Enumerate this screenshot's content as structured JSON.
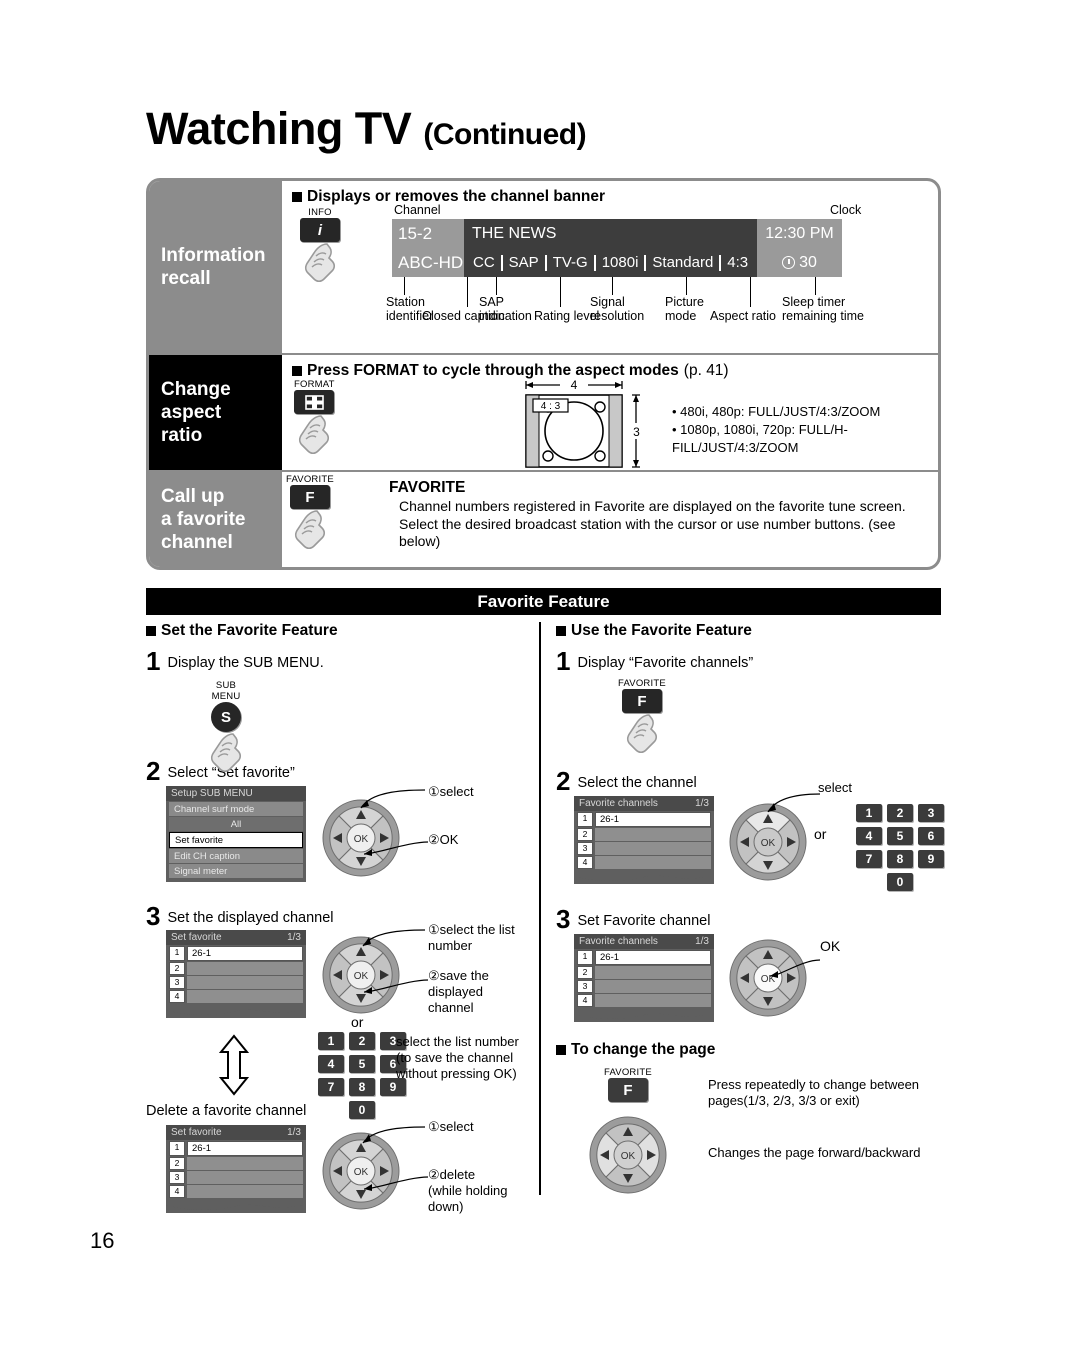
{
  "page": {
    "title_main": "Watching TV",
    "title_cont": "(Continued)",
    "number": "16"
  },
  "feature_table": {
    "rows": [
      {
        "label": "Information\nrecall",
        "label_line1": "Information",
        "label_line2": "recall",
        "heading": "Displays or removes the channel banner",
        "key": {
          "cap": "INFO",
          "glyph": "i"
        },
        "banner": {
          "caption_channel": "Channel",
          "caption_clock": "Clock",
          "channel_number": "15-2",
          "station_identifier": "ABC-HD",
          "program_title": "THE NEWS",
          "clock": "12:30 PM",
          "sleep_timer": "30",
          "items": [
            "CC",
            "SAP",
            "TV-G",
            "1080i",
            "Standard",
            "4:3"
          ],
          "labels": {
            "station": "Station\nidentifier",
            "sap": "SAP\nindication",
            "signal": "Signal\nresolution",
            "picture": "Picture\nmode",
            "sleep": "Sleep timer\nremaining time",
            "closed_caption": "Closed caption",
            "rating": "Rating level",
            "aspect": "Aspect ratio"
          }
        }
      },
      {
        "label_line1": "Change",
        "label_line2": "aspect",
        "label_line3": "ratio",
        "heading": "Press FORMAT to cycle through the aspect modes",
        "heading_page": "(p. 41)",
        "key": {
          "cap": "FORMAT",
          "glyph": "format-icon"
        },
        "diagram": {
          "width_label": "4",
          "height_label": "3",
          "inner_label": "4 : 3"
        },
        "modes": [
          "480i, 480p:  FULL/JUST/4:3/ZOOM",
          "1080p, 1080i, 720p:  FULL/H-FILL/JUST/4:3/ZOOM"
        ]
      },
      {
        "label_line1": "Call up",
        "label_line2": "a favorite",
        "label_line3": "channel",
        "heading": "FAVORITE",
        "key": {
          "cap": "FAVORITE",
          "glyph": "F"
        },
        "body": "Channel numbers registered in Favorite are displayed on the favorite tune screen. Select the desired broadcast station with the cursor or use number buttons. (see below)"
      }
    ]
  },
  "favorite_section": {
    "bar_title": "Favorite Feature",
    "left": {
      "heading": "Set the Favorite Feature",
      "step1": {
        "num": "1",
        "text": "Display the SUB MENU.",
        "key": {
          "cap_line1": "SUB",
          "cap_line2": "MENU",
          "glyph": "S"
        }
      },
      "step2": {
        "num": "2",
        "text": "Select “Set favorite”",
        "menu": {
          "title": "Setup SUB MENU",
          "items": [
            "Channel surf mode",
            "All",
            "Set favorite",
            "Edit CH caption",
            "Signal meter"
          ],
          "selected": "Set favorite"
        },
        "annotations": [
          "①select",
          "②OK"
        ]
      },
      "step3": {
        "num": "3",
        "text": "Set the displayed channel",
        "list": {
          "title": "Set favorite",
          "page": "1/3",
          "rows": [
            {
              "num": "1",
              "value": "26-1"
            },
            {
              "num": "2",
              "value": ""
            },
            {
              "num": "3",
              "value": ""
            },
            {
              "num": "4",
              "value": ""
            }
          ]
        },
        "annotations": [
          "①select the list\n   number",
          "②save the displayed\n   channel"
        ],
        "or_label": "or",
        "numpad": [
          "1",
          "2",
          "3",
          "4",
          "5",
          "6",
          "7",
          "8",
          "9",
          "0"
        ],
        "numpad_note": "select the list number\n(to save the channel\nwithout pressing OK)"
      },
      "delete": {
        "text": "Delete a favorite channel",
        "list": {
          "title": "Set favorite",
          "page": "1/3",
          "rows": [
            {
              "num": "1",
              "value": "26-1"
            },
            {
              "num": "2",
              "value": ""
            },
            {
              "num": "3",
              "value": ""
            },
            {
              "num": "4",
              "value": ""
            }
          ]
        },
        "annotations": [
          "①select",
          "②delete\n   (while holding down)"
        ]
      }
    },
    "right": {
      "heading": "Use the Favorite Feature",
      "step1": {
        "num": "1",
        "text": "Display “Favorite channels”",
        "key": {
          "cap": "FAVORITE",
          "glyph": "F"
        }
      },
      "step2": {
        "num": "2",
        "text": "Select the channel",
        "list": {
          "title": "Favorite channels",
          "page": "1/3",
          "rows": [
            {
              "num": "1",
              "value": "26-1"
            },
            {
              "num": "2",
              "value": ""
            },
            {
              "num": "3",
              "value": ""
            },
            {
              "num": "4",
              "value": ""
            }
          ]
        },
        "annotation": "select",
        "or_label": "or",
        "numpad": [
          "1",
          "2",
          "3",
          "4",
          "5",
          "6",
          "7",
          "8",
          "9",
          "0"
        ]
      },
      "step3": {
        "num": "3",
        "text": "Set Favorite channel",
        "list": {
          "title": "Favorite channels",
          "page": "1/3",
          "rows": [
            {
              "num": "1",
              "value": "26-1"
            },
            {
              "num": "2",
              "value": ""
            },
            {
              "num": "3",
              "value": ""
            },
            {
              "num": "4",
              "value": ""
            }
          ]
        },
        "annotation": "OK"
      },
      "change_page": {
        "heading": "To change the page",
        "key": {
          "cap": "FAVORITE",
          "glyph": "F"
        },
        "note1": "Press repeatedly to change between\npages(1/3, 2/3, 3/3 or exit)",
        "note2": "Changes the page forward/backward"
      }
    }
  },
  "colors": {
    "gray_label": "#8c8c8c",
    "black_label": "#000000",
    "banner_dark": "#3d3d3d",
    "banner_gray": "#9a9a9a",
    "osd_gray": "#8a8a8a"
  }
}
